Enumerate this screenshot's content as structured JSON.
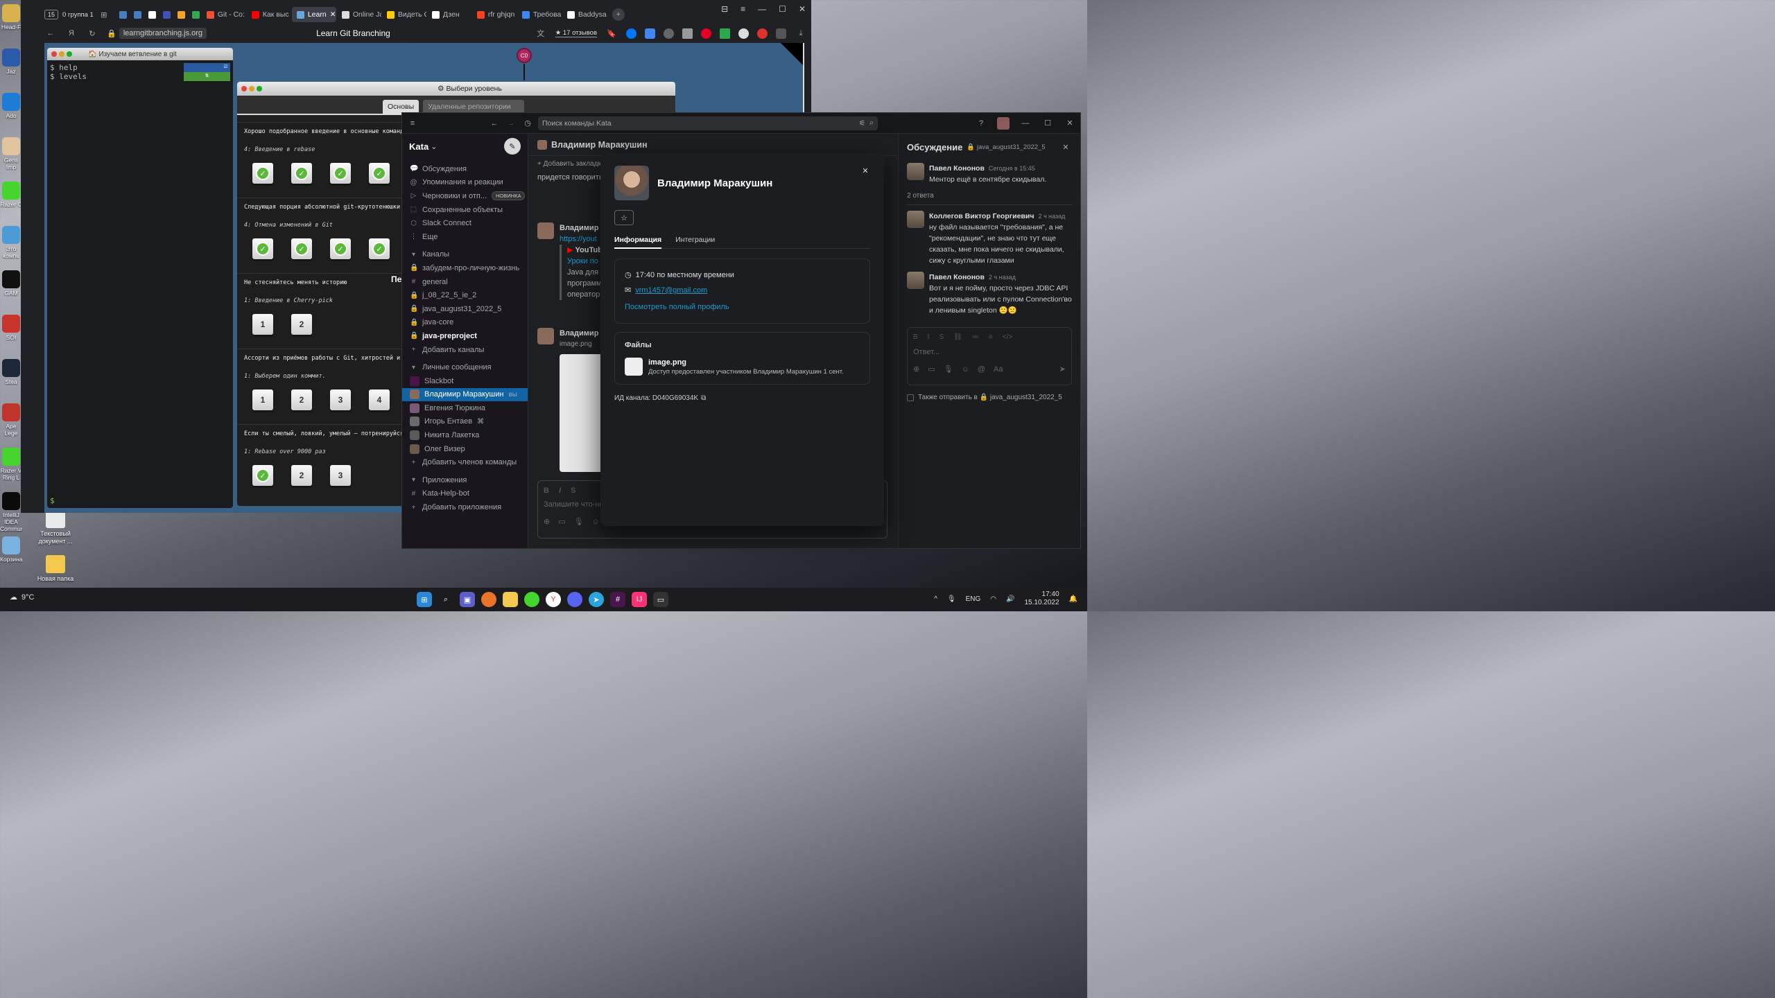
{
  "desktop": {
    "icons": [
      {
        "label": "Head-F",
        "color": "#d8b24c"
      },
      {
        "label": "Jaz",
        "color": "#2b5ba8"
      },
      {
        "label": "Ado",
        "color": "#1e7bd6"
      },
      {
        "label": "Gens Imp",
        "color": "#e0c4a0"
      },
      {
        "label": "Razer C",
        "color": "#44d62c"
      },
      {
        "label": "Это компь",
        "color": "#4a9bd6"
      },
      {
        "label": "GAM",
        "color": "#111111"
      },
      {
        "label": "SOI",
        "color": "#c8332a"
      },
      {
        "label": "Stea",
        "color": "#1b2838"
      },
      {
        "label": "Ape Lege",
        "color": "#c0352b"
      },
      {
        "label": "Razer V Ring L",
        "color": "#44d62c"
      },
      {
        "label": "IntelliJ IDEA Communi...",
        "color": "#0b0b0b"
      },
      {
        "label": "Корзина",
        "color": "#7ab2e0"
      }
    ],
    "icons2": [
      {
        "label": "Текстовый документ ...",
        "color": "#eaeaea"
      },
      {
        "label": "Новая папка",
        "color": "#f2c94c"
      }
    ],
    "weather": "9°C"
  },
  "browser": {
    "tab_count": "15",
    "group_label": "0 группа 1",
    "tabs": [
      {
        "label": "",
        "color": "#4a7dc0"
      },
      {
        "label": "",
        "color": "#4a7dc0"
      },
      {
        "label": "",
        "color": "#ffffff"
      },
      {
        "label": "",
        "color": "#3f51b5"
      },
      {
        "label": "",
        "color": "#f4a32b"
      },
      {
        "label": "",
        "color": "#34a853"
      },
      {
        "label": "Git - Co:",
        "color": "#f05033"
      },
      {
        "label": "Как выс",
        "color": "#ff0000"
      },
      {
        "label": "Learn",
        "color": "#6aa7dc"
      },
      {
        "label": "Online Ja",
        "color": "#dddddd"
      },
      {
        "label": "Видеть С",
        "color": "#ffcc00"
      },
      {
        "label": "Дзен",
        "color": "#ffffff"
      },
      {
        "label": "rfr ghjqn",
        "color": "#fc3f1d"
      },
      {
        "label": "Требова",
        "color": "#4285f4"
      },
      {
        "label": "Baddysa",
        "color": "#ffffff"
      }
    ],
    "url": "learngitbranching.js.org",
    "page_title": "Learn Git Branching",
    "reviews": "★ 17 отзывов"
  },
  "game": {
    "terminal_title": "Изучаем ветвление в git",
    "cmd_help": "$ help",
    "cmd_levels": "$ levels",
    "prompt": "$",
    "commit_label": "C0",
    "dialog_title": "Выбери уровень",
    "tab_basics": "Основы",
    "tab_remote": "Удаленные репозитории",
    "section_heading": "Пе",
    "sections": [
      {
        "desc": "Хорошо подобранное введение в основные команды git",
        "sub": "4: Введение в rebase",
        "levels": [
          "✓",
          "✓",
          "✓",
          "✓"
        ]
      },
      {
        "desc": "Следующая порция абсолютной git-крутотенюшки. Про",
        "sub": "4: Отмена изменений в Git",
        "levels": [
          "✓",
          "✓",
          "✓",
          "✓"
        ]
      },
      {
        "desc": "Не стесняйтесь менять историю",
        "sub": "1: Введение в Cherry-pick",
        "levels": [
          "1",
          "2"
        ]
      },
      {
        "desc": "Ассорти из приёмов работы с Git, хитростей и сове",
        "sub": "1: Выберем один коммит.",
        "levels": [
          "1",
          "2",
          "3",
          "4"
        ]
      },
      {
        "desc": "Если ты смелый, ловкий, умелый – потренируйся тут",
        "sub": "1: Rebase over 9000 раз",
        "levels": [
          "✓",
          "2",
          "3"
        ]
      }
    ]
  },
  "slack": {
    "search_placeholder": "Поиск команды Kata",
    "workspace": "Kata",
    "nav": [
      {
        "icon": "💬",
        "label": "Обсуждения",
        "badge": ""
      },
      {
        "icon": "@",
        "label": "Упоминания и реакции",
        "badge": ""
      },
      {
        "icon": "▷",
        "label": "Черновики и отп...",
        "badge": "НОВИНКА"
      },
      {
        "icon": "⬚",
        "label": "Сохраненные объекты",
        "badge": ""
      },
      {
        "icon": "⬡",
        "label": "Slack Connect",
        "badge": ""
      },
      {
        "icon": "⋮",
        "label": "Еще",
        "badge": ""
      }
    ],
    "channels_header": "Каналы",
    "channels": [
      {
        "icon": "🔒",
        "label": "забудем-про-личную-жизнь",
        "bold": false
      },
      {
        "icon": "#",
        "label": "general",
        "bold": false
      },
      {
        "icon": "🔒",
        "label": "j_08_22_5_ie_2",
        "bold": false
      },
      {
        "icon": "🔒",
        "label": "java_august31_2022_5",
        "bold": false
      },
      {
        "icon": "🔒",
        "label": "java-core",
        "bold": false
      },
      {
        "icon": "🔒",
        "label": "java-preproject",
        "bold": true
      },
      {
        "icon": "+",
        "label": "Добавить каналы",
        "bold": false
      }
    ],
    "dm_header": "Личные сообщения",
    "dms": [
      {
        "label": "Slackbot",
        "suffix": "",
        "active": false,
        "color": "#4a154b"
      },
      {
        "label": "Владимир Маракушин",
        "suffix": "вы",
        "active": true,
        "color": "#8a6a5a"
      },
      {
        "label": "Евгения Тюркина",
        "suffix": "",
        "active": false,
        "color": "#7a5a7a"
      },
      {
        "label": "Игорь Ентаев",
        "suffix": "⌘",
        "active": false,
        "color": "#6a6a6a"
      },
      {
        "label": "Никита Лакетка",
        "suffix": "",
        "active": false,
        "color": "#5a5a5a"
      },
      {
        "label": "Олег Визер",
        "suffix": "",
        "active": false,
        "color": "#6a5a4a"
      },
      {
        "label": "Добавить членов команды",
        "suffix": "",
        "active": false,
        "color": ""
      }
    ],
    "apps_header": "Приложения",
    "apps": [
      {
        "icon": "#",
        "label": "Kata-Help-bot"
      },
      {
        "icon": "+",
        "label": "Добавить приложения"
      }
    ],
    "channel_title": "Владимир Маракушин",
    "add_bookmark": "+ Добавить закладку",
    "bg_msg_text": "придется говорить",
    "bg_author": "Владимир М",
    "bg_link": "https://yout",
    "bg_youtube": "YouTub",
    "bg_yt_title": "Уроки по",
    "bg_body": [
      "Java для н",
      "программ",
      "оператор"
    ],
    "bg_author2": "Владимир М",
    "bg_file": "image.png",
    "composer_placeholder": "Запишите что-ни",
    "thread": {
      "title": "Обсуждение",
      "channel": "java_august31_2022_5",
      "messages": [
        {
          "author": "Павел Кононов",
          "time": "Сегодня в 15:45",
          "text": "Ментор ещё в сентябре скидывал."
        },
        {
          "author": "Коллегов Виктор Георгиевич",
          "time": "2 ч назад",
          "text": "ну файл называется \"требования\", а не \"рекомендации\", не знаю что тут еще сказать, мне пока ничего не скидывали, сижу с круглыми глазами"
        },
        {
          "author": "Павел Кононов",
          "time": "2 ч назад",
          "text": "Вот и я не пойму, просто через JDBC API реализовывать или с пулом Connection'во и ленивым singleton 🙁🙁"
        }
      ],
      "replies_count": "2 ответа",
      "reply_placeholder": "Ответ...",
      "also_send": "Также отправить в 🔒 java_august31_2022_5"
    },
    "profile": {
      "name": "Владимир Маракушин",
      "tab_info": "Информация",
      "tab_integrations": "Интеграции",
      "local_time": "17:40 по местному времени",
      "email": "vrm1457@gmail.com",
      "full_profile_link": "Посмотреть полный профиль",
      "files_title": "Файлы",
      "file_name": "image.png",
      "file_meta": "Доступ предоставлен участником Владимир Маракушин 1 сент.",
      "channel_id": "ИД канала: D040G69034K"
    }
  },
  "taskbar": {
    "lang": "ENG",
    "time": "17:40",
    "date": "15.10.2022"
  }
}
